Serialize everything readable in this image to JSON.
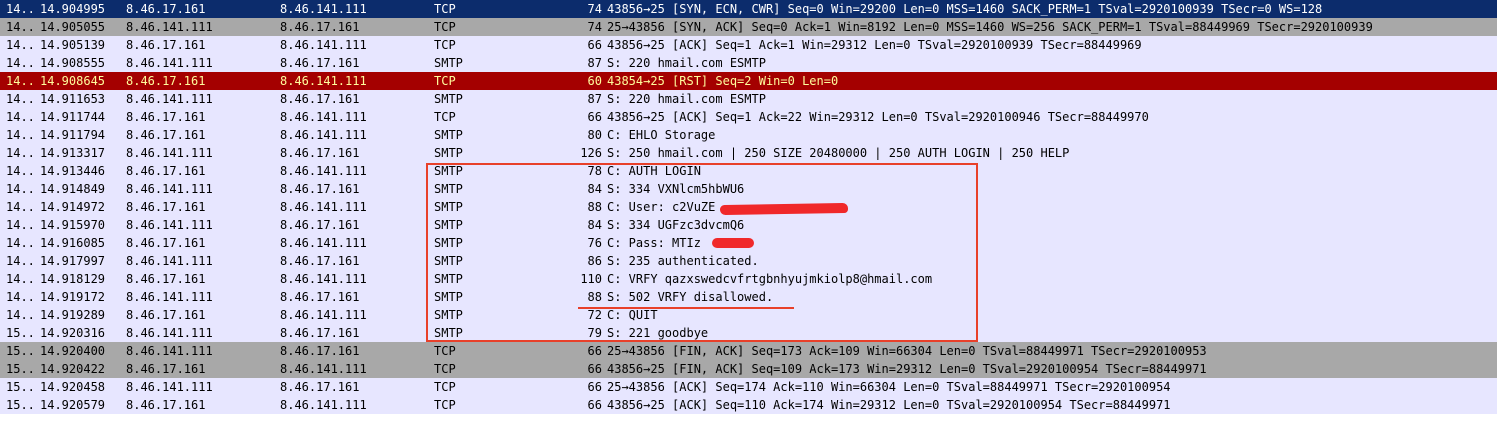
{
  "colors": {
    "selected_bg": "#0c2c6c",
    "gray_bg": "#a8a8a8",
    "tcp_bg": "#e7e6ff",
    "rst_bg": "#a40000",
    "rst_fg": "#fffc9c",
    "annotation_red": "#e8402a"
  },
  "packets": [
    {
      "style": "selected",
      "no": "14...",
      "time": "14.904995",
      "src": "8.46.17.161",
      "dst": "8.46.141.111",
      "proto": "TCP",
      "len": "74",
      "info": "43856→25 [SYN, ECN, CWR] Seq=0 Win=29200 Len=0 MSS=1460 SACK_PERM=1 TSval=2920100939 TSecr=0 WS=128"
    },
    {
      "style": "gray",
      "no": "14...",
      "time": "14.905055",
      "src": "8.46.141.111",
      "dst": "8.46.17.161",
      "proto": "TCP",
      "len": "74",
      "info": "25→43856 [SYN, ACK] Seq=0 Ack=1 Win=8192 Len=0 MSS=1460 WS=256 SACK_PERM=1 TSval=88449969 TSecr=2920100939"
    },
    {
      "style": "tcp",
      "no": "14...",
      "time": "14.905139",
      "src": "8.46.17.161",
      "dst": "8.46.141.111",
      "proto": "TCP",
      "len": "66",
      "info": "43856→25 [ACK] Seq=1 Ack=1 Win=29312 Len=0 TSval=2920100939 TSecr=88449969"
    },
    {
      "style": "tcp",
      "no": "14...",
      "time": "14.908555",
      "src": "8.46.141.111",
      "dst": "8.46.17.161",
      "proto": "SMTP",
      "len": "87",
      "info": "S: 220 hmail.com ESMTP"
    },
    {
      "style": "rst",
      "no": "14...",
      "time": "14.908645",
      "src": "8.46.17.161",
      "dst": "8.46.141.111",
      "proto": "TCP",
      "len": "60",
      "info": "43854→25 [RST] Seq=2 Win=0 Len=0"
    },
    {
      "style": "tcp",
      "no": "14...",
      "time": "14.911653",
      "src": "8.46.141.111",
      "dst": "8.46.17.161",
      "proto": "SMTP",
      "len": "87",
      "info": "S: 220 hmail.com ESMTP"
    },
    {
      "style": "tcp",
      "no": "14...",
      "time": "14.911744",
      "src": "8.46.17.161",
      "dst": "8.46.141.111",
      "proto": "TCP",
      "len": "66",
      "info": "43856→25 [ACK] Seq=1 Ack=22 Win=29312 Len=0 TSval=2920100946 TSecr=88449970"
    },
    {
      "style": "tcp",
      "no": "14...",
      "time": "14.911794",
      "src": "8.46.17.161",
      "dst": "8.46.141.111",
      "proto": "SMTP",
      "len": "80",
      "info": "C: EHLO Storage"
    },
    {
      "style": "tcp",
      "no": "14...",
      "time": "14.913317",
      "src": "8.46.141.111",
      "dst": "8.46.17.161",
      "proto": "SMTP",
      "len": "126",
      "info": "S: 250 hmail.com | 250 SIZE 20480000 | 250 AUTH LOGIN | 250 HELP"
    },
    {
      "style": "tcp",
      "no": "14...",
      "time": "14.913446",
      "src": "8.46.17.161",
      "dst": "8.46.141.111",
      "proto": "SMTP",
      "len": "78",
      "info": "C: AUTH LOGIN"
    },
    {
      "style": "tcp",
      "no": "14...",
      "time": "14.914849",
      "src": "8.46.141.111",
      "dst": "8.46.17.161",
      "proto": "SMTP",
      "len": "84",
      "info": "S: 334 VXNlcm5hbWU6"
    },
    {
      "style": "tcp",
      "no": "14...",
      "time": "14.914972",
      "src": "8.46.17.161",
      "dst": "8.46.141.111",
      "proto": "SMTP",
      "len": "88",
      "info": "C: User: c2VuZE"
    },
    {
      "style": "tcp",
      "no": "14...",
      "time": "14.915970",
      "src": "8.46.141.111",
      "dst": "8.46.17.161",
      "proto": "SMTP",
      "len": "84",
      "info": "S: 334 UGFzc3dvcmQ6"
    },
    {
      "style": "tcp",
      "no": "14...",
      "time": "14.916085",
      "src": "8.46.17.161",
      "dst": "8.46.141.111",
      "proto": "SMTP",
      "len": "76",
      "info": "C: Pass: MTIz"
    },
    {
      "style": "tcp",
      "no": "14...",
      "time": "14.917997",
      "src": "8.46.141.111",
      "dst": "8.46.17.161",
      "proto": "SMTP",
      "len": "86",
      "info": "S: 235 authenticated."
    },
    {
      "style": "tcp",
      "no": "14...",
      "time": "14.918129",
      "src": "8.46.17.161",
      "dst": "8.46.141.111",
      "proto": "SMTP",
      "len": "110",
      "info": "C: VRFY qazxswedcvfrtgbnhyujmkiolp8@hmail.com"
    },
    {
      "style": "tcp",
      "no": "14...",
      "time": "14.919172",
      "src": "8.46.141.111",
      "dst": "8.46.17.161",
      "proto": "SMTP",
      "len": "88",
      "info": "S: 502 VRFY disallowed."
    },
    {
      "style": "tcp",
      "no": "14...",
      "time": "14.919289",
      "src": "8.46.17.161",
      "dst": "8.46.141.111",
      "proto": "SMTP",
      "len": "72",
      "info": "C: QUIT"
    },
    {
      "style": "tcp",
      "no": "15...",
      "time": "14.920316",
      "src": "8.46.141.111",
      "dst": "8.46.17.161",
      "proto": "SMTP",
      "len": "79",
      "info": "S: 221 goodbye"
    },
    {
      "style": "gray",
      "no": "15...",
      "time": "14.920400",
      "src": "8.46.141.111",
      "dst": "8.46.17.161",
      "proto": "TCP",
      "len": "66",
      "info": "25→43856 [FIN, ACK] Seq=173 Ack=109 Win=66304 Len=0 TSval=88449971 TSecr=2920100953"
    },
    {
      "style": "gray",
      "no": "15...",
      "time": "14.920422",
      "src": "8.46.17.161",
      "dst": "8.46.141.111",
      "proto": "TCP",
      "len": "66",
      "info": "43856→25 [FIN, ACK] Seq=109 Ack=173 Win=29312 Len=0 TSval=2920100954 TSecr=88449971"
    },
    {
      "style": "tcp",
      "no": "15...",
      "time": "14.920458",
      "src": "8.46.141.111",
      "dst": "8.46.17.161",
      "proto": "TCP",
      "len": "66",
      "info": "25→43856 [ACK] Seq=174 Ack=110 Win=66304 Len=0 TSval=88449971 TSecr=2920100954"
    },
    {
      "style": "tcp",
      "no": "15...",
      "time": "14.920579",
      "src": "8.46.17.161",
      "dst": "8.46.141.111",
      "proto": "TCP",
      "len": "66",
      "info": "43856→25 [ACK] Seq=110 Ack=174 Win=29312 Len=0 TSval=2920100954 TSecr=88449971"
    }
  ]
}
